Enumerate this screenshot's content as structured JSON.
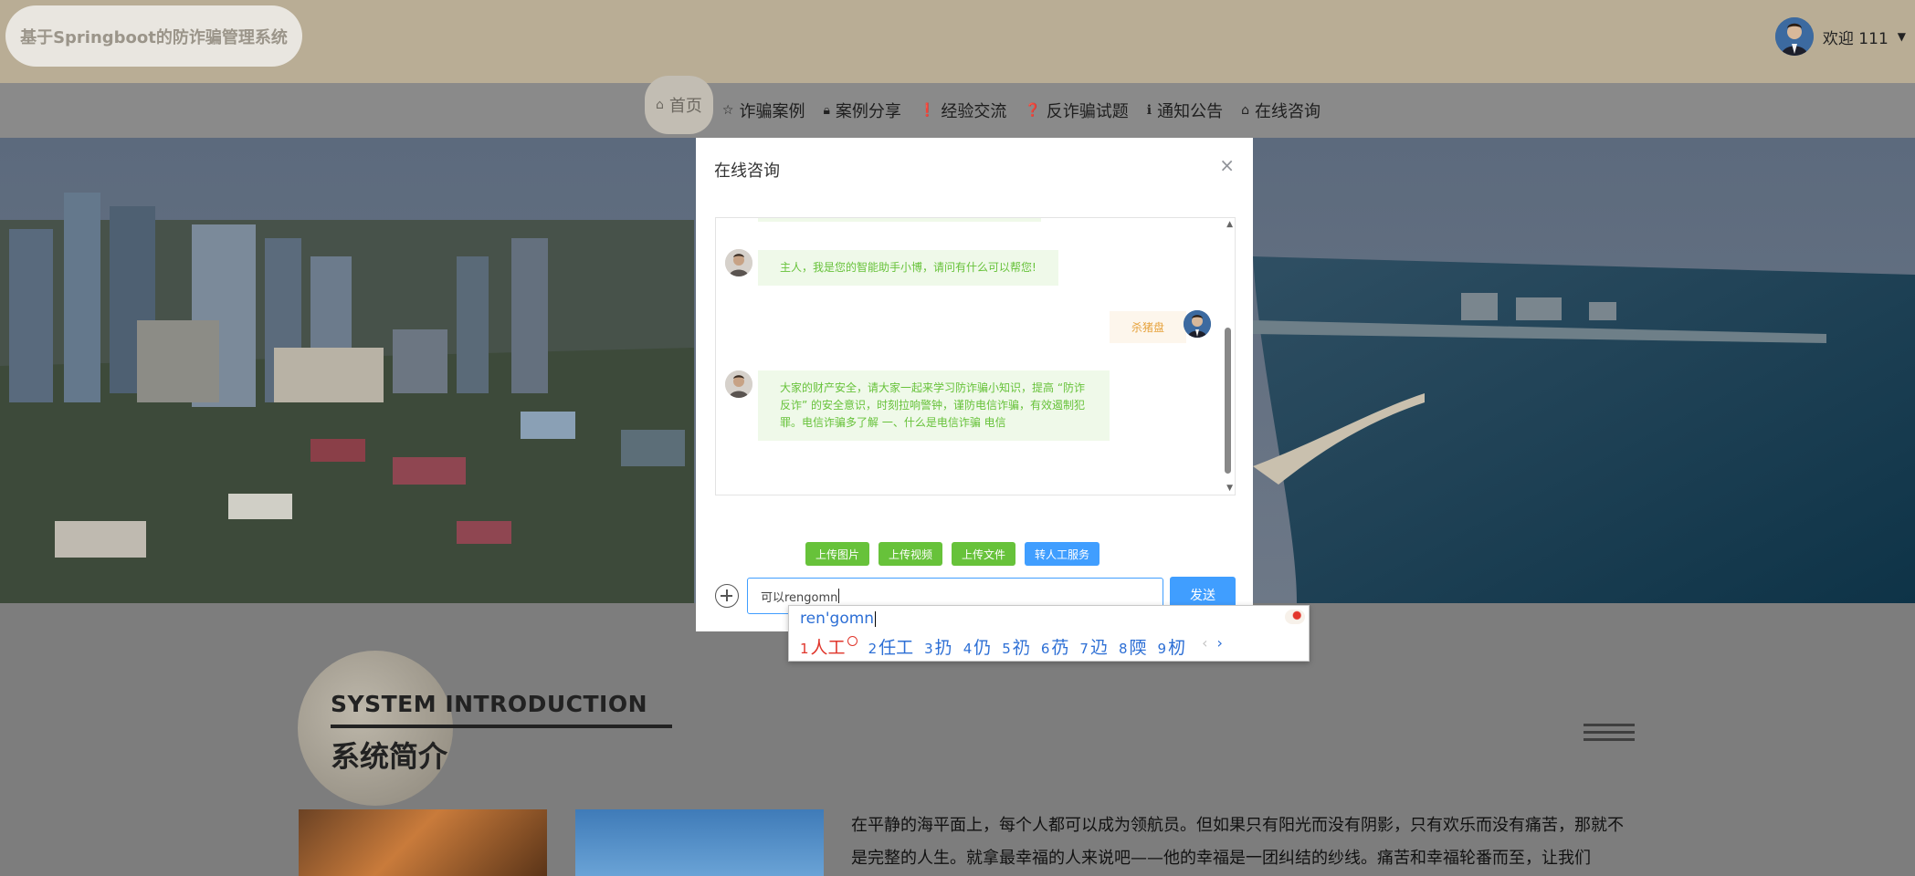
{
  "header": {
    "brand": "基于Springboot的防诈骗管理系统",
    "welcome": "欢迎 111",
    "caret": "▼"
  },
  "nav": {
    "items": [
      {
        "icon": "⌂",
        "label": "首页",
        "icon_name": "home-icon",
        "active": true
      },
      {
        "icon": "☆",
        "label": "诈骗案例",
        "icon_name": "star-icon"
      },
      {
        "icon": "🔒︎",
        "label": "案例分享",
        "icon_name": "bag-icon"
      },
      {
        "icon": "❗",
        "label": "经验交流",
        "icon_name": "exclamation-icon"
      },
      {
        "icon": "❓",
        "label": "反诈骗试题",
        "icon_name": "question-icon"
      },
      {
        "icon": "ℹ",
        "label": "通知公告",
        "icon_name": "info-icon"
      },
      {
        "icon": "⌂",
        "label": "在线咨询",
        "icon_name": "home-icon"
      }
    ]
  },
  "intro": {
    "title_en": "SYSTEM INTRODUCTION",
    "title_zh": "系统简介",
    "text": "在平静的海平面上，每个人都可以成为领航员。但如果只有阳光而没有阴影，只有欢乐而没有痛苦，那就不是完整的人生。就拿最幸福的人来说吧——他的幸福是一团纠结的纱线。痛苦和幸福轮番而至，让我们"
  },
  "modal": {
    "title": "在线咨询",
    "close": "×",
    "messages": [
      {
        "from": "bot",
        "text": "主人，我是您的智能助手小博，请问有什么可以帮您!"
      },
      {
        "from": "user",
        "text": "杀猪盘"
      },
      {
        "from": "bot",
        "text": "大家的财产安全，请大家一起来学习防诈骗小知识，提高 “防诈反诈” 的安全意识，时刻拉响警钟，谨防电信诈骗，有效遏制犯罪。电信诈骗多了解 一、什么是电信诈骗 电信"
      }
    ],
    "buttons": [
      {
        "label": "上传图片",
        "color": "#67c23a"
      },
      {
        "label": "上传视频",
        "color": "#67c23a"
      },
      {
        "label": "上传文件",
        "color": "#67c23a"
      },
      {
        "label": "转人工服务",
        "color": "#409eff"
      }
    ],
    "input_value": "可以rengomn",
    "send_label": "发送"
  },
  "ime": {
    "composition": "ren'gomn",
    "candidates": [
      {
        "num": "1",
        "text": "人工"
      },
      {
        "num": "2",
        "text": "任工"
      },
      {
        "num": "3",
        "text": "扔"
      },
      {
        "num": "4",
        "text": "仍"
      },
      {
        "num": "5",
        "text": "礽"
      },
      {
        "num": "6",
        "text": "芿"
      },
      {
        "num": "7",
        "text": "辸"
      },
      {
        "num": "8",
        "text": "陾"
      },
      {
        "num": "9",
        "text": "杒"
      }
    ],
    "prev": "‹",
    "next": "›"
  },
  "colors": {
    "header_bg": "#b9ad95",
    "bot_bubble": "#eff9e9",
    "bot_text": "#67c23a",
    "user_bubble": "#fdf6ec",
    "user_text": "#e6a23c",
    "primary": "#409eff",
    "success": "#67c23a"
  }
}
